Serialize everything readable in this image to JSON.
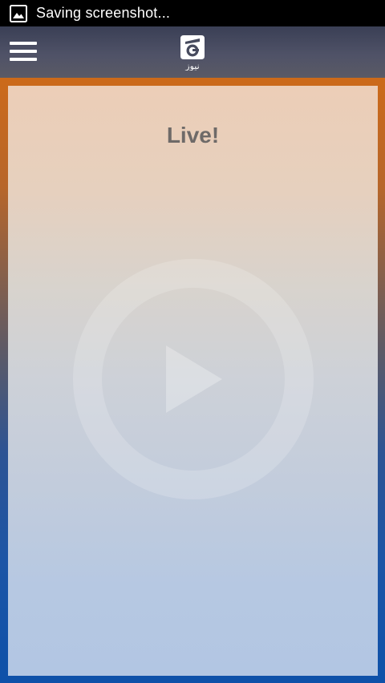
{
  "status_bar": {
    "icon": "image-icon",
    "notification_text": "Saving screenshot..."
  },
  "app_bar": {
    "menu_icon": "hamburger-menu-icon",
    "logo_icon": "geo-news-logo-icon",
    "logo_text": "نیوز"
  },
  "content": {
    "live_label": "Live!",
    "play_icon": "play-icon"
  },
  "colors": {
    "status_bar": "#000000",
    "app_bar": "#474b5e",
    "frame_top": "#cc6a1a",
    "frame_bottom": "#0e51a9",
    "card_top": "#ecceb7",
    "card_bottom": "#b2c6e3",
    "live_text": "#6e6a68"
  }
}
